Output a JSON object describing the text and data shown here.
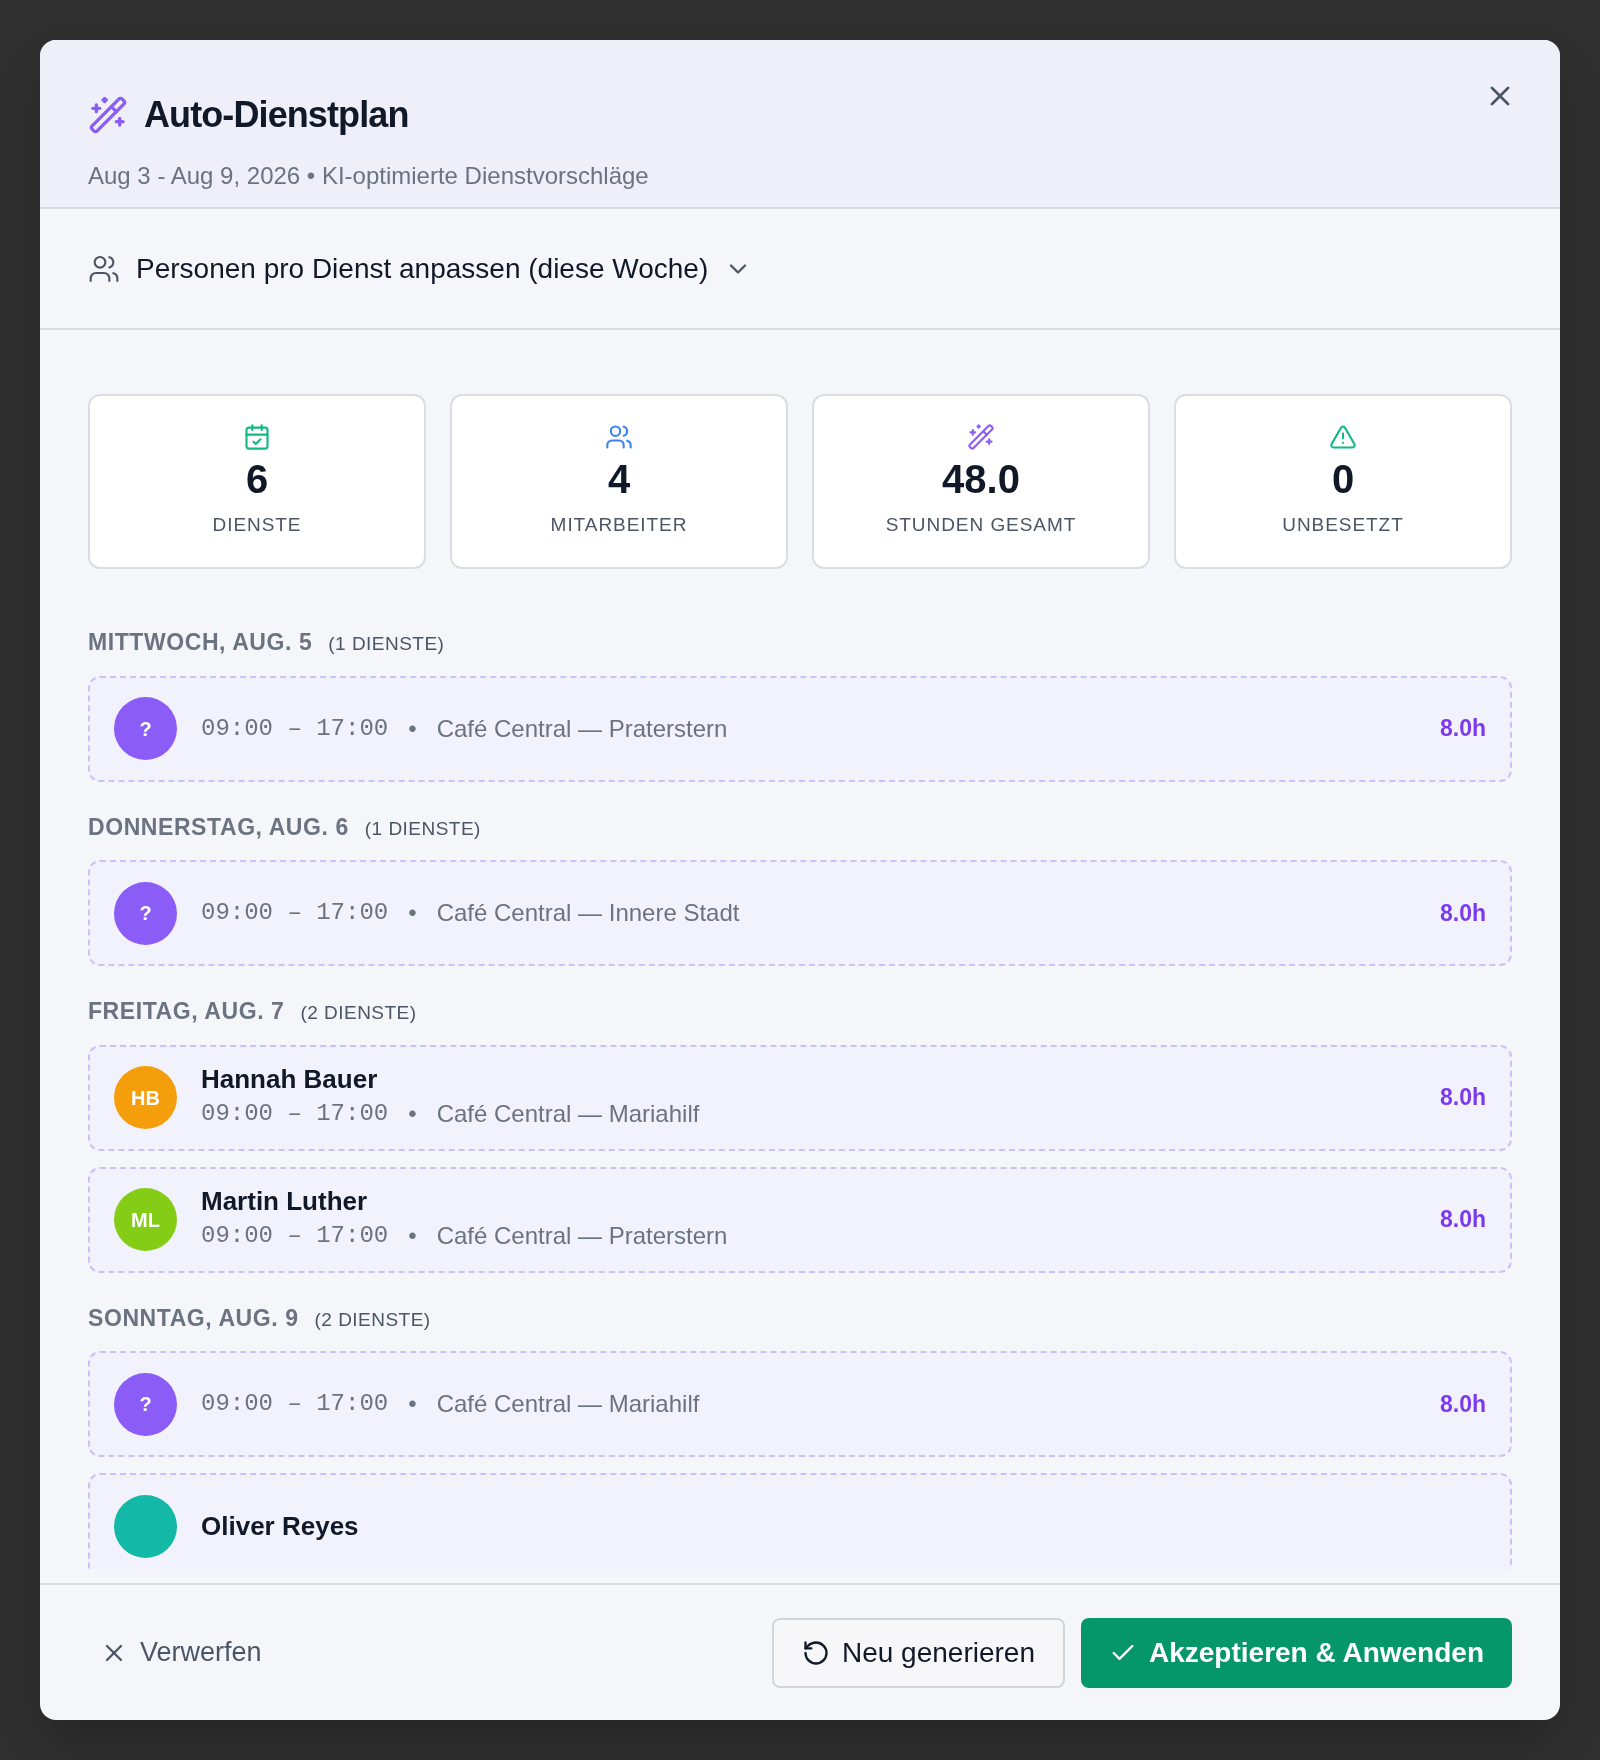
{
  "dialog": {
    "title": "Auto-Dienstplan",
    "subtitle": "Aug 3 - Aug 9, 2026 • KI-optimierte Dienstvorschläge"
  },
  "staffing_toggle": {
    "label": "Personen pro Dienst anpassen (diese Woche)",
    "expanded": false
  },
  "stats": [
    {
      "kind": "calendar",
      "value": "6",
      "label": "DIENSTE"
    },
    {
      "kind": "users",
      "value": "4",
      "label": "MITARBEITER"
    },
    {
      "kind": "wand",
      "value": "48.0",
      "label": "STUNDEN GESAMT"
    },
    {
      "kind": "warning",
      "value": "0",
      "label": "UNBESETZT"
    }
  ],
  "days": [
    {
      "heading": "MITTWOCH, AUG. 5",
      "count": "(1 DIENSTE)",
      "shifts": [
        {
          "kind": "unassigned",
          "avatar": "?",
          "color": "#8b5cf6",
          "time": "09:00 – 17:00",
          "separator": "•",
          "location": "Café Central — Praterstern",
          "hours": "8.0h"
        }
      ]
    },
    {
      "heading": "DONNERSTAG, AUG. 6",
      "count": "(1 DIENSTE)",
      "shifts": [
        {
          "kind": "unassigned",
          "avatar": "?",
          "color": "#8b5cf6",
          "time": "09:00 – 17:00",
          "separator": "•",
          "location": "Café Central — Innere Stadt",
          "hours": "8.0h"
        }
      ]
    },
    {
      "heading": "FREITAG, AUG. 7",
      "count": "(2 DIENSTE)",
      "shifts": [
        {
          "kind": "assigned",
          "avatar": "HB",
          "color": "#f59e0b",
          "name": "Hannah Bauer",
          "time": "09:00 – 17:00",
          "separator": "•",
          "location": "Café Central — Mariahilf",
          "hours": "8.0h"
        },
        {
          "kind": "assigned",
          "avatar": "ML",
          "color": "#84cc16",
          "name": "Martin Luther",
          "time": "09:00 – 17:00",
          "separator": "•",
          "location": "Café Central — Praterstern",
          "hours": "8.0h"
        }
      ]
    },
    {
      "heading": "SONNTAG, AUG. 9",
      "count": "(2 DIENSTE)",
      "shifts": [
        {
          "kind": "unassigned",
          "avatar": "?",
          "color": "#8b5cf6",
          "time": "09:00 – 17:00",
          "separator": "•",
          "location": "Café Central — Mariahilf",
          "hours": "8.0h"
        },
        {
          "kind": "assigned",
          "color": "#14b8a6",
          "name": "Oliver Reyes"
        }
      ]
    }
  ],
  "footer": {
    "discard": "Verwerfen",
    "regenerate": "Neu generieren",
    "accept": "Akzeptieren & Anwenden"
  }
}
